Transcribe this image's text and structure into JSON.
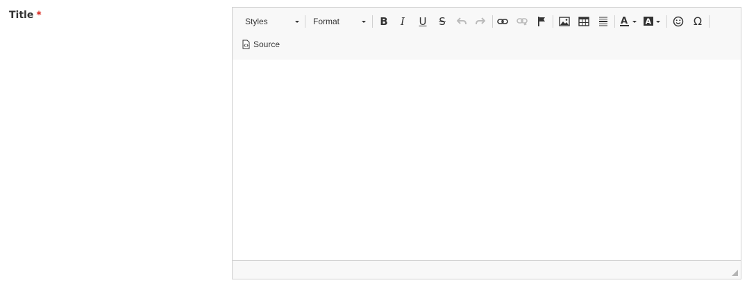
{
  "field": {
    "label": "Title",
    "required_mark": "*"
  },
  "editor": {
    "toolbar": {
      "styles_label": "Styles",
      "format_label": "Format",
      "source_label": "Source",
      "buttons": [
        "bold-icon",
        "italic-icon",
        "underline-icon",
        "strikethrough-icon",
        "undo-icon",
        "redo-icon",
        "link-icon",
        "unlink-icon",
        "anchor-flag-icon",
        "image-icon",
        "table-icon",
        "horizontal-line-icon",
        "text-color-icon",
        "background-color-icon",
        "smiley-icon",
        "special-char-icon"
      ]
    },
    "content": ""
  },
  "colors": {
    "required": "#d9251d",
    "toolbar_bg": "#f8f8f8",
    "border": "#d1d1d1"
  }
}
